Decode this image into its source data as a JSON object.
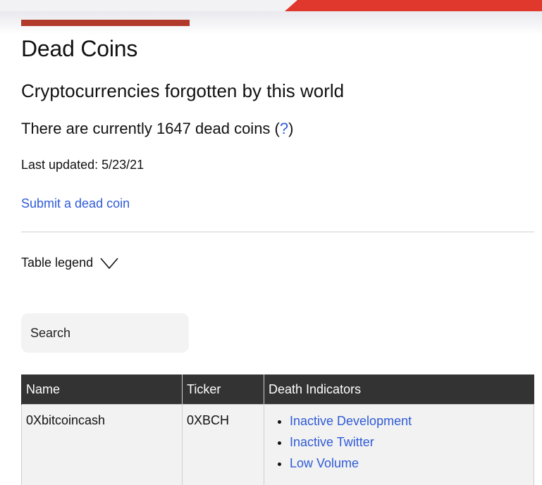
{
  "header": {
    "accent_color": "#e0382c",
    "bar_color": "#b23a2a"
  },
  "page": {
    "title": "Dead Coins",
    "subtitle": "Cryptocurrencies forgotten by this world",
    "count_prefix": "There are currently 1647 dead coins (",
    "count_help": "?",
    "count_suffix": ")",
    "last_updated": "Last updated: 5/23/21",
    "submit_link": "Submit a dead coin",
    "legend_toggle": "Table legend",
    "legend_icon": "chevron-down-icon"
  },
  "search": {
    "placeholder": "Search"
  },
  "table": {
    "headers": [
      "Name",
      "Ticker",
      "Death Indicators"
    ],
    "rows": [
      {
        "name": "0Xbitcoincash",
        "ticker": "0XBCH",
        "indicators": [
          "Inactive Development",
          "Inactive Twitter",
          "Low Volume"
        ]
      }
    ]
  }
}
